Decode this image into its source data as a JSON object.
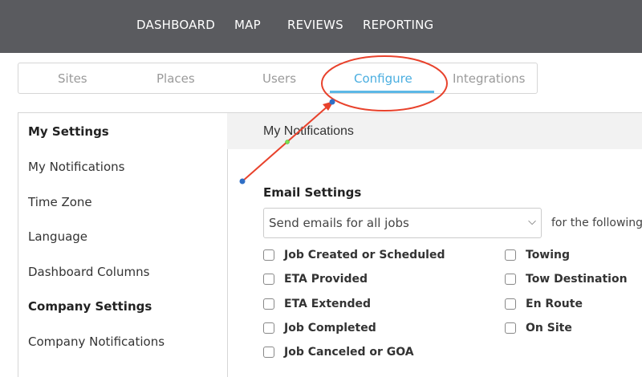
{
  "topnav": [
    "DASHBOARD",
    "MAP",
    "REVIEWS",
    "REPORTING"
  ],
  "tabs": [
    "Sites",
    "Places",
    "Users",
    "Configure",
    "Integrations"
  ],
  "active_tab": "Configure",
  "sidebar": {
    "items": [
      {
        "label": "My Settings",
        "heading": true
      },
      {
        "label": "My Notifications"
      },
      {
        "label": "Time Zone"
      },
      {
        "label": "Language"
      },
      {
        "label": "Dashboard Columns"
      },
      {
        "label": "Company Settings",
        "heading": true
      },
      {
        "label": "Company Notifications"
      }
    ]
  },
  "panel": {
    "title": "My Notifications",
    "email_heading": "Email Settings",
    "select_value": "Send emails for all jobs",
    "following_text": "for the following s",
    "checkboxes_left": [
      "Job Created or Scheduled",
      "ETA Provided",
      "ETA Extended",
      "Job Completed",
      "Job Canceled or GOA"
    ],
    "checkboxes_right": [
      "Towing",
      "Tow Destination",
      "En Route",
      "On Site"
    ]
  },
  "colors": {
    "topbar": "#5a5b5f",
    "accent": "#4aaee0",
    "annotation": "#e8422c"
  }
}
